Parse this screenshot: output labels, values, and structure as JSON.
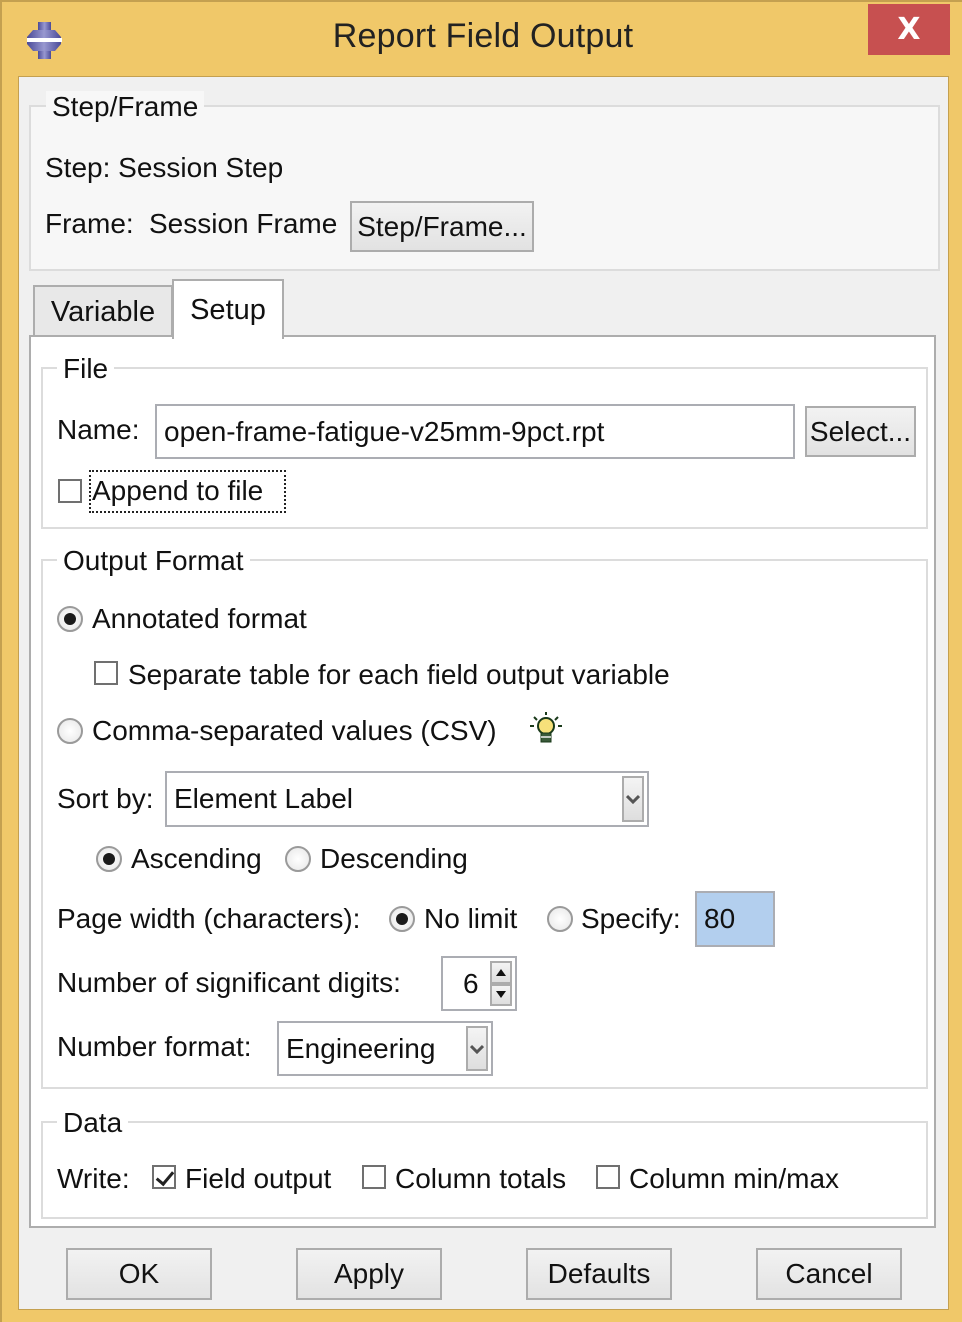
{
  "window": {
    "title": "Report Field Output",
    "close_label": "X",
    "app_icon": "abaqus-logo-icon"
  },
  "step_frame": {
    "group_label": "Step/Frame",
    "step_text": "Step: Session Step",
    "frame_label": "Frame:",
    "frame_value": "Session Frame",
    "button_label": "Step/Frame..."
  },
  "tabs": [
    {
      "label": "Variable",
      "active": false
    },
    {
      "label": "Setup",
      "active": true
    }
  ],
  "file": {
    "group_label": "File",
    "name_label": "Name:",
    "name_value": "open-frame-fatigue-v25mm-9pct.rpt",
    "select_label": "Select...",
    "append_label": "Append to file",
    "append_checked": false
  },
  "output_format": {
    "group_label": "Output Format",
    "annotated_label": "Annotated format",
    "annotated_selected": true,
    "separate_table_label": "Separate table for each field output variable",
    "separate_table_checked": false,
    "csv_label": "Comma-separated values (CSV)",
    "csv_selected": false,
    "csv_hint_icon": "lightbulb-icon",
    "sort_by_label": "Sort by:",
    "sort_by_value": "Element Label",
    "ascending_label": "Ascending",
    "ascending_selected": true,
    "descending_label": "Descending",
    "descending_selected": false,
    "page_width_label": "Page width (characters):",
    "no_limit_label": "No limit",
    "no_limit_selected": true,
    "specify_label": "Specify:",
    "specify_selected": false,
    "specify_value": "80",
    "sig_digits_label": "Number of significant digits:",
    "sig_digits_value": "6",
    "number_format_label": "Number format:",
    "number_format_value": "Engineering"
  },
  "data": {
    "group_label": "Data",
    "write_label": "Write:",
    "field_output_label": "Field output",
    "field_output_checked": true,
    "column_totals_label": "Column totals",
    "column_totals_checked": false,
    "column_minmax_label": "Column min/max",
    "column_minmax_checked": false
  },
  "buttons": {
    "ok": "OK",
    "apply": "Apply",
    "defaults": "Defaults",
    "cancel": "Cancel"
  },
  "colors": {
    "frame": "#f0c869",
    "close": "#c75050",
    "highlight_field": "#b3cfee"
  }
}
